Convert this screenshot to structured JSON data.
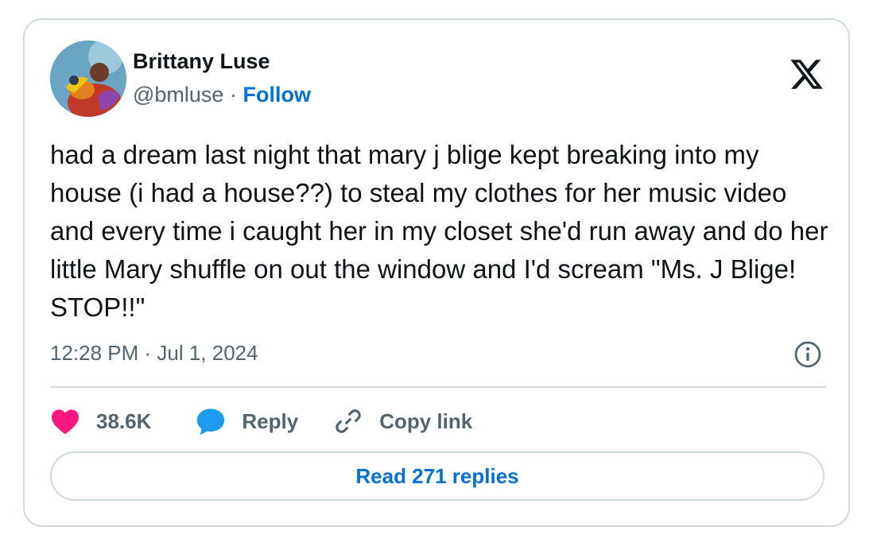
{
  "tweet": {
    "author": {
      "display_name": "Brittany Luse",
      "handle": "@bmluse",
      "separator": "·",
      "follow_label": "Follow"
    },
    "text": "had a dream last night that mary j blige kept breaking into my house (i had a house??) to steal my clothes for her music video and every time i caught her in my closet she'd run away and do her little Mary shuffle on out the window and I'd scream \"Ms. J Blige! STOP!!\"",
    "timestamp": "12:28 PM · Jul 1, 2024",
    "actions": {
      "like_count": "38.6K",
      "reply_label": "Reply",
      "copy_label": "Copy link"
    },
    "read_replies_label": "Read 271 replies"
  },
  "icons": {
    "logo": "x-logo-icon",
    "info": "info-icon",
    "like": "heart-icon",
    "reply": "speech-bubble-icon",
    "copy": "link-icon"
  },
  "colors": {
    "text_primary": "#0f1419",
    "text_secondary": "#536471",
    "link_blue": "#006fd6",
    "like_pink": "#f91880",
    "reply_blue": "#1d9bf0",
    "border": "#cfd9de"
  }
}
